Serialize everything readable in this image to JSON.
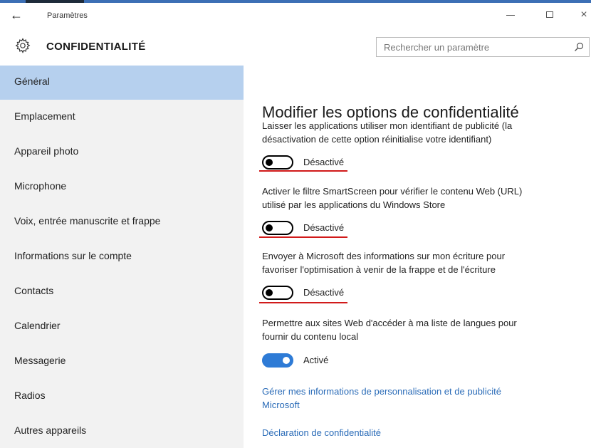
{
  "window": {
    "back_glyph": "←",
    "title": "Paramètres",
    "minimize_icon": "minimize-icon",
    "maximize_icon": "maximize-icon",
    "close_glyph": "×"
  },
  "header": {
    "section_title": "CONFIDENTIALITÉ",
    "section_icon": "gear-icon",
    "search_placeholder": "Rechercher un paramètre",
    "search_icon": "search-icon"
  },
  "sidebar": {
    "items": [
      {
        "label": "Général",
        "selected": true
      },
      {
        "label": "Emplacement"
      },
      {
        "label": "Appareil photo"
      },
      {
        "label": "Microphone"
      },
      {
        "label": "Voix, entrée manuscrite et frappe"
      },
      {
        "label": "Informations sur le compte"
      },
      {
        "label": "Contacts"
      },
      {
        "label": "Calendrier"
      },
      {
        "label": "Messagerie"
      },
      {
        "label": "Radios"
      },
      {
        "label": "Autres appareils"
      }
    ]
  },
  "main": {
    "heading": "Modifier les options de confidentialité",
    "options": [
      {
        "line1": "Laisser les applications utiliser mon identifiant de publicité (la",
        "line2": "désactivation de cette option réinitialise votre identifiant)",
        "state": "Désactivé",
        "on": false
      },
      {
        "line1": "Activer le filtre SmartScreen pour vérifier le contenu Web (URL)",
        "line2": "utilisé par les applications du Windows Store",
        "state": "Désactivé",
        "on": false
      },
      {
        "line1": "Envoyer à Microsoft des informations sur mon écriture pour",
        "line2": "favoriser l'optimisation à venir de la frappe et de l'écriture",
        "state": "Désactivé",
        "on": false
      },
      {
        "line1": "Permettre aux sites Web d'accéder à ma liste de langues pour",
        "line2": "fournir du contenu local",
        "state": "Activé",
        "on": true
      }
    ],
    "links": [
      {
        "line1": "Gérer mes informations de personnalisation et de publicité",
        "line2": "Microsoft"
      },
      {
        "line1": "Déclaration de confidentialité"
      }
    ]
  },
  "colors": {
    "accent": "#2e7bd6",
    "selection": "#b6d0ee",
    "link": "#2b6cb8",
    "annotation_underline": "#d11a1a"
  }
}
